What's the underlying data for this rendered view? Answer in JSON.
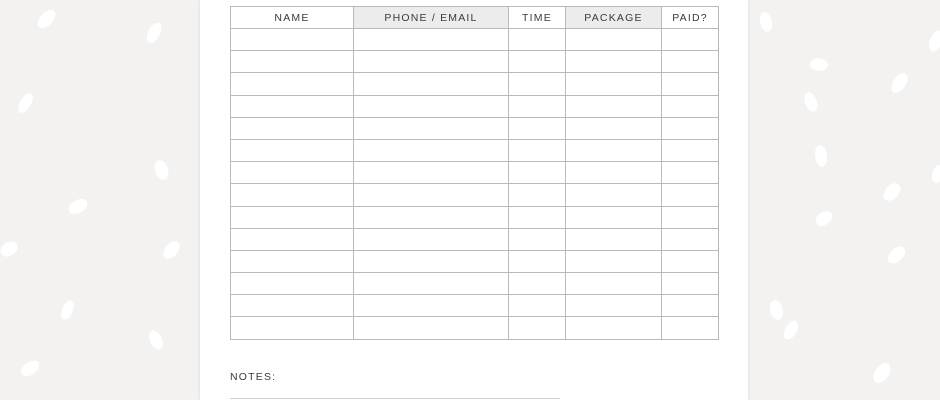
{
  "table": {
    "headers": [
      "NAME",
      "PHONE / EMAIL",
      "TIME",
      "PACKAGE",
      "PAID?"
    ],
    "rows": [
      [
        "",
        "",
        "",
        "",
        ""
      ],
      [
        "",
        "",
        "",
        "",
        ""
      ],
      [
        "",
        "",
        "",
        "",
        ""
      ],
      [
        "",
        "",
        "",
        "",
        ""
      ],
      [
        "",
        "",
        "",
        "",
        ""
      ],
      [
        "",
        "",
        "",
        "",
        ""
      ],
      [
        "",
        "",
        "",
        "",
        ""
      ],
      [
        "",
        "",
        "",
        "",
        ""
      ],
      [
        "",
        "",
        "",
        "",
        ""
      ],
      [
        "",
        "",
        "",
        "",
        ""
      ],
      [
        "",
        "",
        "",
        "",
        ""
      ],
      [
        "",
        "",
        "",
        "",
        ""
      ],
      [
        "",
        "",
        "",
        "",
        ""
      ],
      [
        "",
        "",
        "",
        "",
        ""
      ]
    ]
  },
  "notes": {
    "label": "NOTES:"
  },
  "colors": {
    "background": "#f4f2f0",
    "sheet": "#ffffff",
    "header_shade": "#ececec",
    "grid_line": "#b9b9b9",
    "text": "#3a3a3a"
  }
}
